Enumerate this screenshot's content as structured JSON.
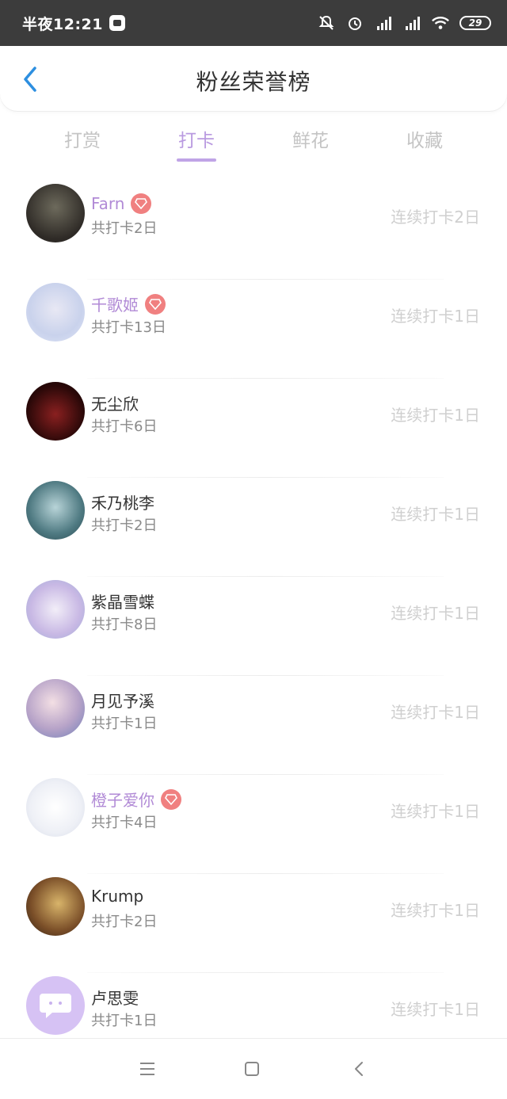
{
  "status": {
    "time": "半夜12:21",
    "battery": "29"
  },
  "header": {
    "title": "粉丝荣誉榜"
  },
  "tabs": [
    {
      "label": "打赏"
    },
    {
      "label": "打卡"
    },
    {
      "label": "鲜花"
    },
    {
      "label": "收藏"
    }
  ],
  "active_tab": 1,
  "fans": [
    {
      "name": "Farn",
      "total": "共打卡2日",
      "streak": "连续打卡2日",
      "vip": true
    },
    {
      "name": "千歌姬",
      "total": "共打卡13日",
      "streak": "连续打卡1日",
      "vip": true
    },
    {
      "name": "无尘欣",
      "total": "共打卡6日",
      "streak": "连续打卡1日",
      "vip": false
    },
    {
      "name": "禾乃桃李",
      "total": "共打卡2日",
      "streak": "连续打卡1日",
      "vip": false
    },
    {
      "name": "紫晶雪蝶",
      "total": "共打卡8日",
      "streak": "连续打卡1日",
      "vip": false
    },
    {
      "name": "月见予溪",
      "total": "共打卡1日",
      "streak": "连续打卡1日",
      "vip": false
    },
    {
      "name": "橙子爱你",
      "total": "共打卡4日",
      "streak": "连续打卡1日",
      "vip": true
    },
    {
      "name": "Krump",
      "total": "共打卡2日",
      "streak": "连续打卡1日",
      "vip": false
    },
    {
      "name": "卢思雯",
      "total": "共打卡1日",
      "streak": "连续打卡1日",
      "vip": false
    }
  ],
  "colors": {
    "accent": "#b99ae0",
    "vip_name": "#b18ad6",
    "badge": "#f08080",
    "back_arrow": "#2d8fe0"
  }
}
